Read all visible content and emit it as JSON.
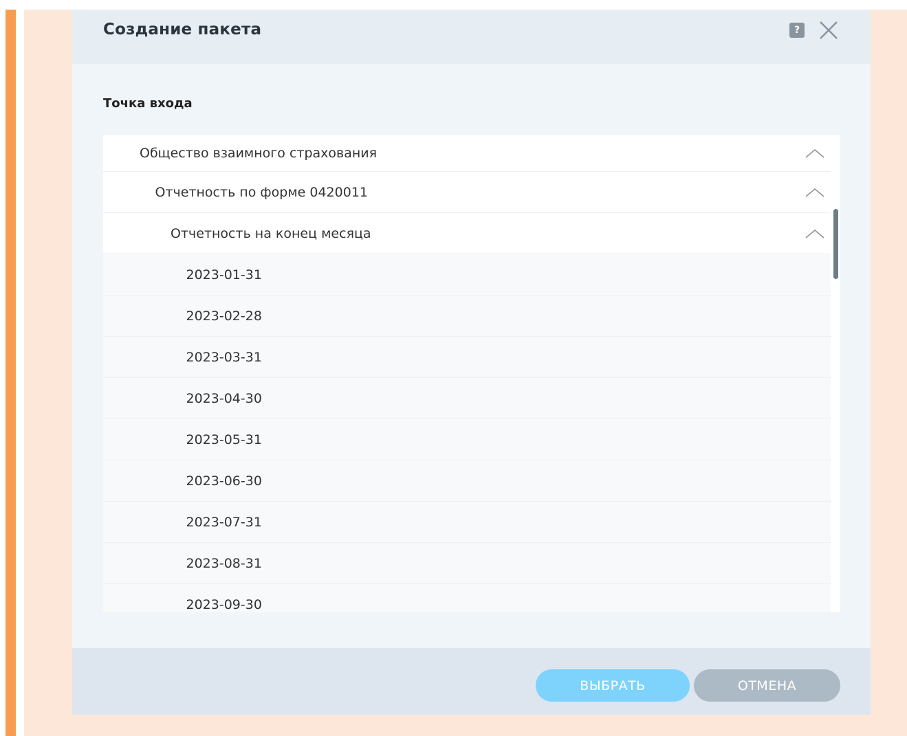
{
  "dialog": {
    "title": "Создание пакета",
    "help_icon_glyph": "?",
    "close_icon": "close-icon",
    "section_label": "Точка входа"
  },
  "tree": {
    "nodes": [
      {
        "label": "Общество взаимного страхования",
        "level": 1,
        "expanded": true
      },
      {
        "label": "Отчетность по форме 0420011",
        "level": 2,
        "expanded": true
      },
      {
        "label": "Отчетность на конец месяца",
        "level": 3,
        "expanded": true
      },
      {
        "label": "2023-01-31",
        "level": 4
      },
      {
        "label": "2023-02-28",
        "level": 4
      },
      {
        "label": "2023-03-31",
        "level": 4
      },
      {
        "label": "2023-04-30",
        "level": 4
      },
      {
        "label": "2023-05-31",
        "level": 4
      },
      {
        "label": "2023-06-30",
        "level": 4
      },
      {
        "label": "2023-07-31",
        "level": 4
      },
      {
        "label": "2023-08-31",
        "level": 4
      },
      {
        "label": "2023-09-30",
        "level": 4
      }
    ]
  },
  "footer": {
    "select_label": "ВЫБРАТЬ",
    "cancel_label": "ОТМЕНА"
  },
  "colors": {
    "accent_bar": "#f79d4f",
    "backdrop": "#fce7d8",
    "primary_button": "#7dd3fb",
    "secondary_button": "#acbac6"
  }
}
